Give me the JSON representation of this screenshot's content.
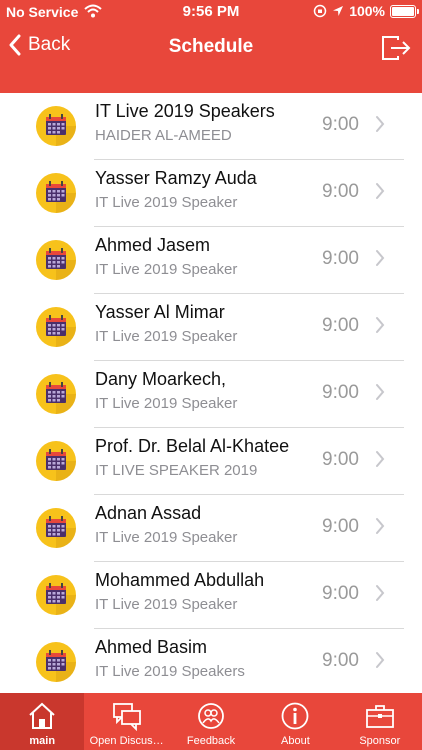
{
  "status_bar": {
    "carrier": "No Service",
    "time": "9:56 PM",
    "battery": "100%"
  },
  "nav": {
    "back_label": "Back",
    "title": "Schedule"
  },
  "schedule": [
    {
      "title": "IT Live 2019 Speakers",
      "subtitle": "HAIDER AL-AMEED",
      "time": "9:00"
    },
    {
      "title": "Yasser Ramzy Auda",
      "subtitle": "IT Live 2019 Speaker",
      "time": "9:00"
    },
    {
      "title": "Ahmed Jasem",
      "subtitle": "IT Live 2019 Speaker",
      "time": "9:00"
    },
    {
      "title": "Yasser Al Mimar",
      "subtitle": "IT Live 2019 Speaker",
      "time": "9:00"
    },
    {
      "title": "Dany Moarkech,",
      "subtitle": "IT Live 2019 Speaker",
      "time": "9:00"
    },
    {
      "title": "Prof. Dr. Belal Al-Khatee",
      "subtitle": "IT LIVE SPEAKER 2019",
      "time": "9:00"
    },
    {
      "title": "Adnan Assad",
      "subtitle": "IT Live 2019 Speaker",
      "time": "9:00"
    },
    {
      "title": "Mohammed Abdullah",
      "subtitle": "IT Live 2019 Speaker",
      "time": "9:00"
    },
    {
      "title": "Ahmed Basim",
      "subtitle": "IT Live 2019 Speakers",
      "time": "9:00"
    }
  ],
  "tabs": [
    {
      "label": "main",
      "icon": "home-icon"
    },
    {
      "label": "Open Discus…",
      "icon": "chat-icon"
    },
    {
      "label": "Feedback",
      "icon": "feedback-icon"
    },
    {
      "label": "About",
      "icon": "info-icon"
    },
    {
      "label": "Sponsor",
      "icon": "briefcase-icon"
    }
  ],
  "colors": {
    "brand": "#e8473b",
    "active_tab": "#c9372d",
    "icon_circle": "#f7c21b",
    "calendar": "#4a2f6b"
  }
}
